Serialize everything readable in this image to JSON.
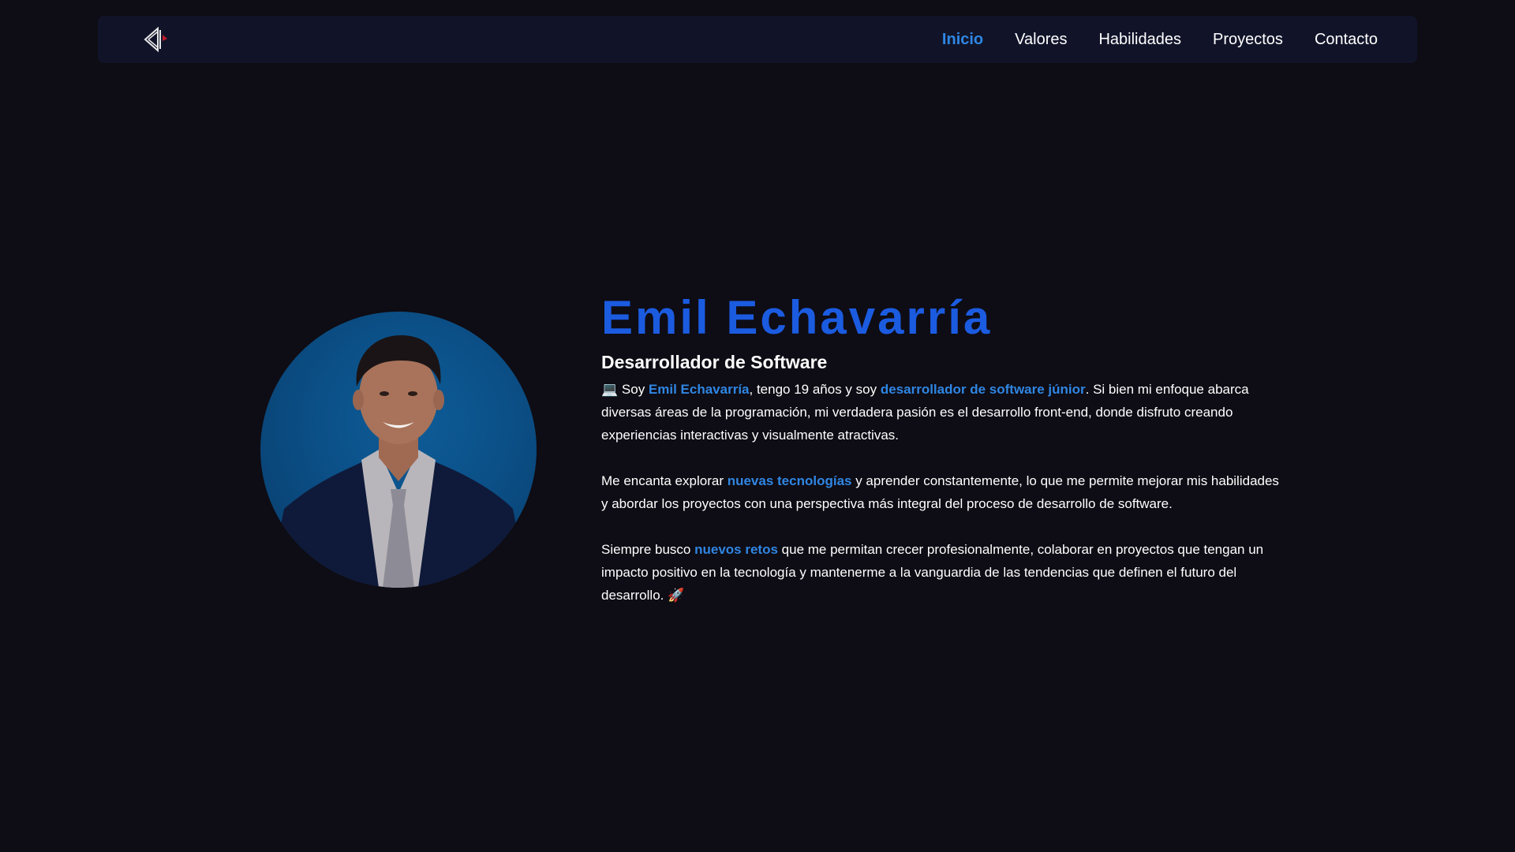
{
  "nav": {
    "logo_icon": "triangle-logo-icon",
    "links": [
      "Inicio",
      "Valores",
      "Habilidades",
      "Proyectos",
      "Contacto"
    ],
    "active": "Inicio"
  },
  "hero": {
    "name": "Emil Echavarría",
    "role": "Desarrollador de Software",
    "p1": {
      "emoji": "💻",
      "t1": " Soy ",
      "h1": "Emil Echavarría",
      "t2": ", tengo 19 años y soy ",
      "h2": "desarrollador de software júnior",
      "t3": ". Si bien mi enfoque abarca diversas áreas de la programación, mi verdadera pasión es el desarrollo front-end, donde disfruto creando experiencias interactivas y visualmente atractivas."
    },
    "p2": {
      "t1": "Me encanta explorar ",
      "h1": "nuevas tecnologías",
      "t2": " y aprender constantemente, lo que me permite mejorar mis habilidades y abordar los proyectos con una perspectiva más integral del proceso de desarrollo de software."
    },
    "p3": {
      "t1": "Siempre busco ",
      "h1": "nuevos retos",
      "t2": " que me permitan crecer profesionalmente, colaborar en proyectos que tengan un impacto positivo en la tecnología y mantenerme a la vanguardia de las tendencias que definen el futuro del desarrollo. ",
      "emoji": "🚀"
    }
  },
  "colors": {
    "background": "#0e0c14",
    "navbar": "#111429",
    "accent": "#2f86e3",
    "name": "#1b5be0"
  }
}
